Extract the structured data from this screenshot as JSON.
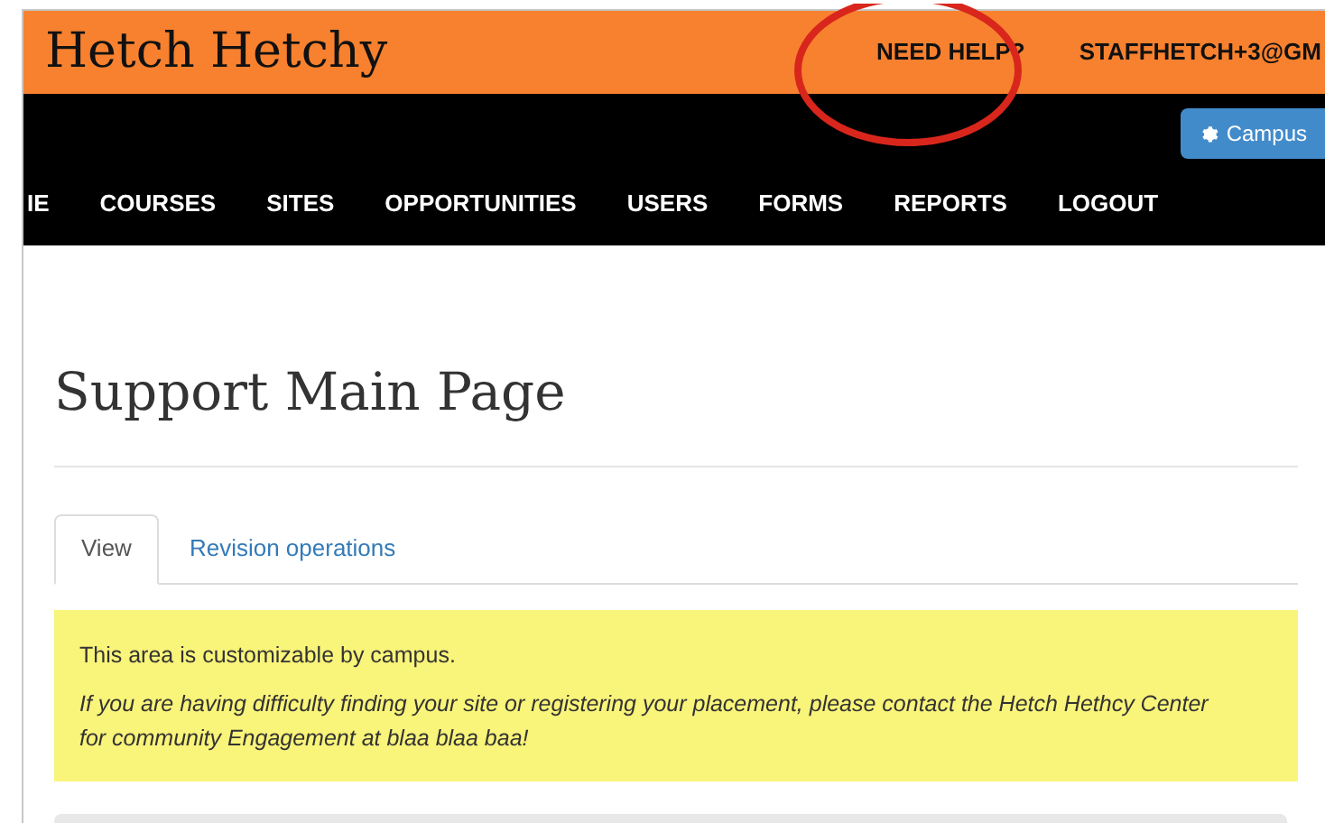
{
  "header": {
    "logo": "Hetch Hetchy",
    "help_link": "NEED HELP?",
    "user": "STAFFHETCH+3@GM"
  },
  "campus_button": {
    "label": "Campus"
  },
  "nav": [
    "IE",
    "COURSES",
    "SITES",
    "OPPORTUNITIES",
    "USERS",
    "FORMS",
    "REPORTS",
    "LOGOUT"
  ],
  "page_title": "Support Main Page",
  "tabs": [
    {
      "label": "View",
      "selected": true
    },
    {
      "label": "Revision operations",
      "selected": false
    }
  ],
  "notice": {
    "lines": [
      {
        "text": "This area is customizable by campus.",
        "italic": false
      },
      {
        "text": "If you are having difficulty finding your site or registering your placement, please contact the Hetch Hethcy Center for community Engagement at blaa blaa baa!",
        "italic": true
      }
    ]
  }
}
